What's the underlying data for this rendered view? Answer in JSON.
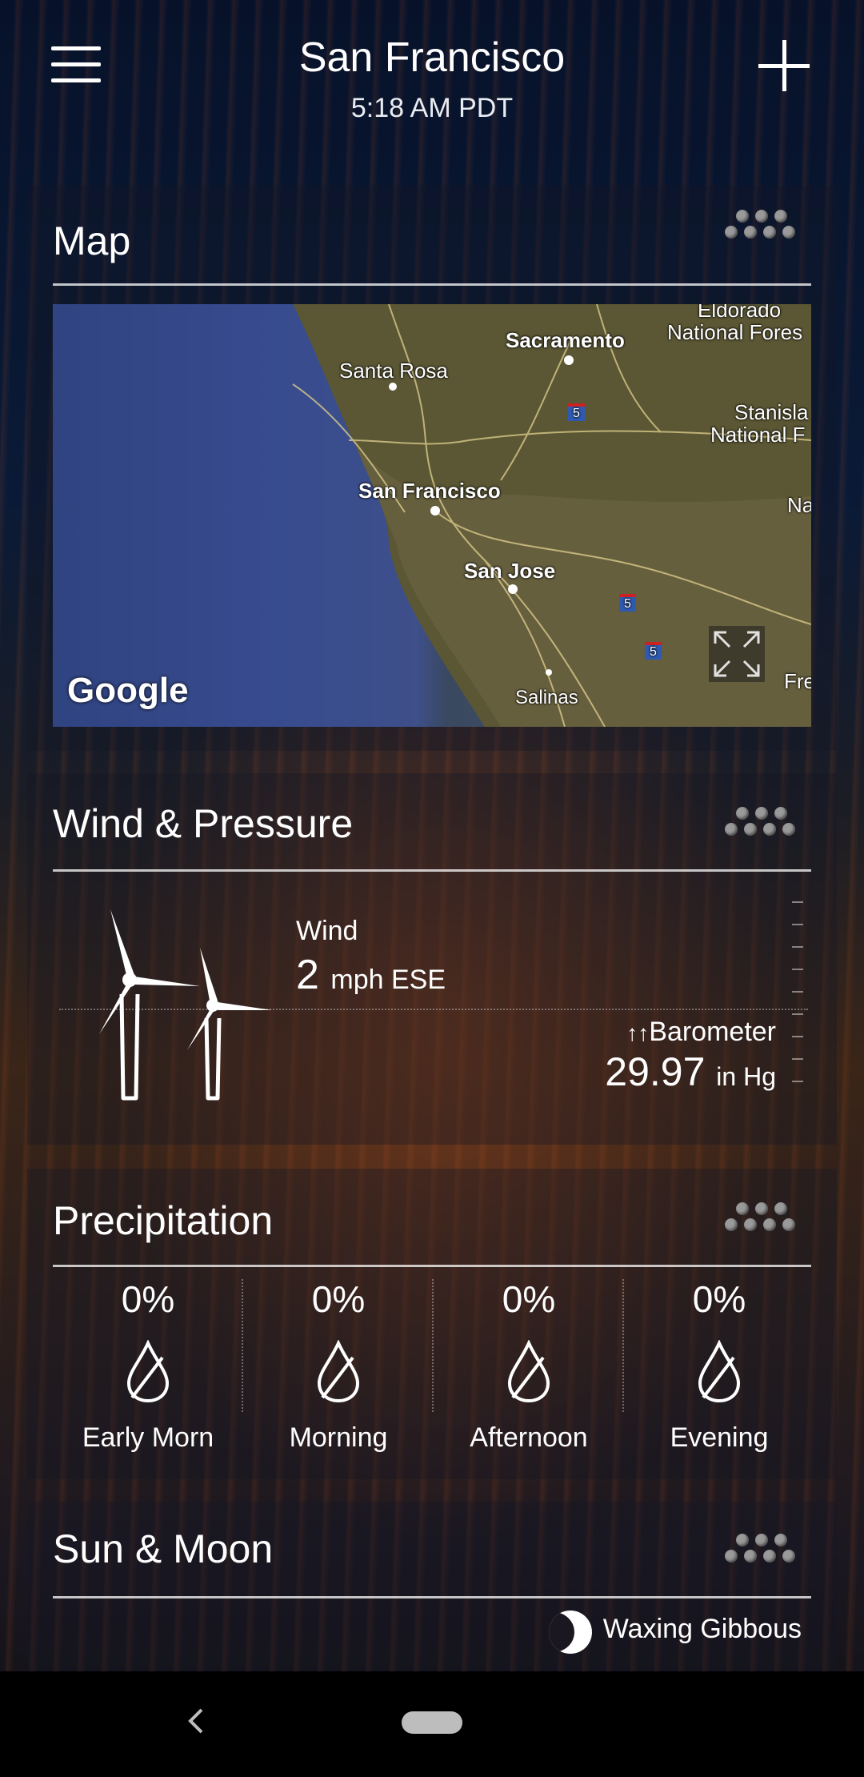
{
  "header": {
    "city": "San Francisco",
    "time": "5:18 AM PDT"
  },
  "icons": {
    "menu": "hamburger-menu-icon",
    "add": "plus-icon",
    "more": "more-dots-icon",
    "drop": "raindrop-icon",
    "wind": "wind-turbine-icon",
    "moon": "moon-phase-icon",
    "expand": "expand-icon",
    "back": "back-chevron-icon",
    "home": "home-pill-icon"
  },
  "map_card": {
    "title": "Map",
    "logo": "Google",
    "labels": {
      "sacramento": "Sacramento",
      "santa_rosa": "Santa Rosa",
      "san_francisco": "San Francisco",
      "san_jose": "San Jose",
      "salinas": "Salinas",
      "eldorado": "Eldorado",
      "eldorado_forest": "National Fores",
      "stanislaus": "Stanisla",
      "stanislaus_forest": "National F",
      "na": "Na",
      "fre": "Fre",
      "i5_a": "5",
      "i5_b": "5",
      "i5_c": "5"
    }
  },
  "wind_card": {
    "title": "Wind & Pressure",
    "wind_label": "Wind",
    "wind_speed": "2",
    "wind_unit": "mph ESE",
    "baro_arrows": "↑↑",
    "baro_label": "Barometer",
    "baro_value": "29.97",
    "baro_unit": "in Hg"
  },
  "precip_card": {
    "title": "Precipitation",
    "periods": [
      {
        "label": "Early Morn",
        "chance": "0%"
      },
      {
        "label": "Morning",
        "chance": "0%"
      },
      {
        "label": "Afternoon",
        "chance": "0%"
      },
      {
        "label": "Evening",
        "chance": "0%"
      }
    ]
  },
  "sun_moon_card": {
    "title": "Sun & Moon",
    "moon_phase": "Waxing Gibbous"
  },
  "colors": {
    "rule": "#d8d8d8",
    "dots": "#9a9a9a",
    "navbar": "#000000"
  }
}
